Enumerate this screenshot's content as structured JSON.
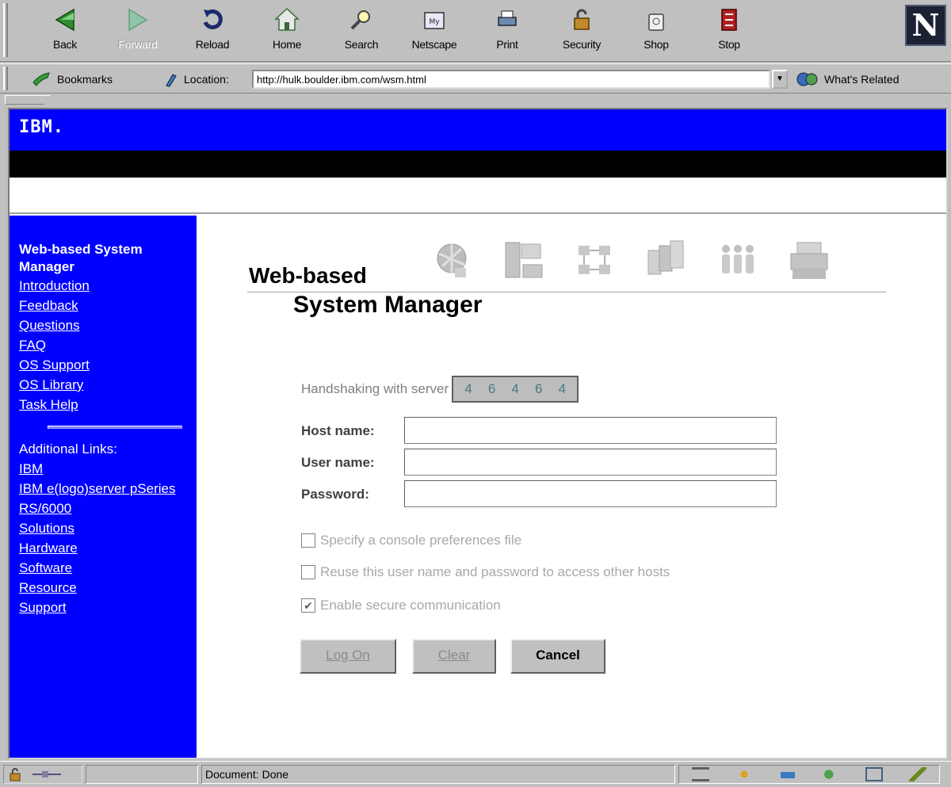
{
  "browser": {
    "nav_buttons": [
      {
        "label": "Back",
        "icon": "back-icon",
        "enabled": true
      },
      {
        "label": "Forward",
        "icon": "forward-icon",
        "enabled": false
      },
      {
        "label": "Reload",
        "icon": "reload-icon",
        "enabled": true
      },
      {
        "label": "Home",
        "icon": "home-icon",
        "enabled": true
      },
      {
        "label": "Search",
        "icon": "search-icon",
        "enabled": true
      },
      {
        "label": "Netscape",
        "icon": "netscape-icon",
        "enabled": true
      },
      {
        "label": "Print",
        "icon": "print-icon",
        "enabled": true
      },
      {
        "label": "Security",
        "icon": "security-lock-icon",
        "enabled": true
      },
      {
        "label": "Shop",
        "icon": "shop-icon",
        "enabled": true
      },
      {
        "label": "Stop",
        "icon": "stop-icon",
        "enabled": true
      }
    ],
    "brand_letter": "N",
    "bookmarks_label": "Bookmarks",
    "location_label": "Location:",
    "url": "http://hulk.boulder.ibm.com/wsm.html",
    "whats_related_label": "What's Related",
    "status_text": "Document: Done"
  },
  "page": {
    "header_logo": "IBM.",
    "sidebar": {
      "title": "Web-based System Manager",
      "links": [
        "Introduction",
        "Feedback",
        "Questions",
        "FAQ",
        "OS Support",
        "OS Library",
        "Task Help"
      ],
      "additional_label": "Additional Links:",
      "additional_links": [
        "IBM",
        "IBM e(logo)server pSeries",
        "RS/6000",
        "Solutions",
        "Hardware",
        "Software",
        "Resource",
        "Support"
      ]
    },
    "main": {
      "title_line1": "Web-based",
      "title_line2": "System Manager",
      "handshake_label": "Handshaking with server",
      "handshake_digits": [
        "4",
        "6",
        "4",
        "6",
        "4"
      ],
      "host_label": "Host name:",
      "host_value": "",
      "user_label": "User name:",
      "user_value": "",
      "password_label": "Password:",
      "password_value": "",
      "checkboxes": [
        {
          "label": "Specify a console preferences file",
          "checked": false
        },
        {
          "label": "Reuse this user name and password to access other hosts",
          "checked": false
        },
        {
          "label": "Enable secure communication",
          "checked": true
        }
      ],
      "buttons": {
        "logon": "Log On",
        "clear": "Clear",
        "cancel": "Cancel"
      }
    }
  },
  "colors": {
    "ibm_blue": "#0000ff",
    "chrome_gray": "#c0c0c0"
  }
}
